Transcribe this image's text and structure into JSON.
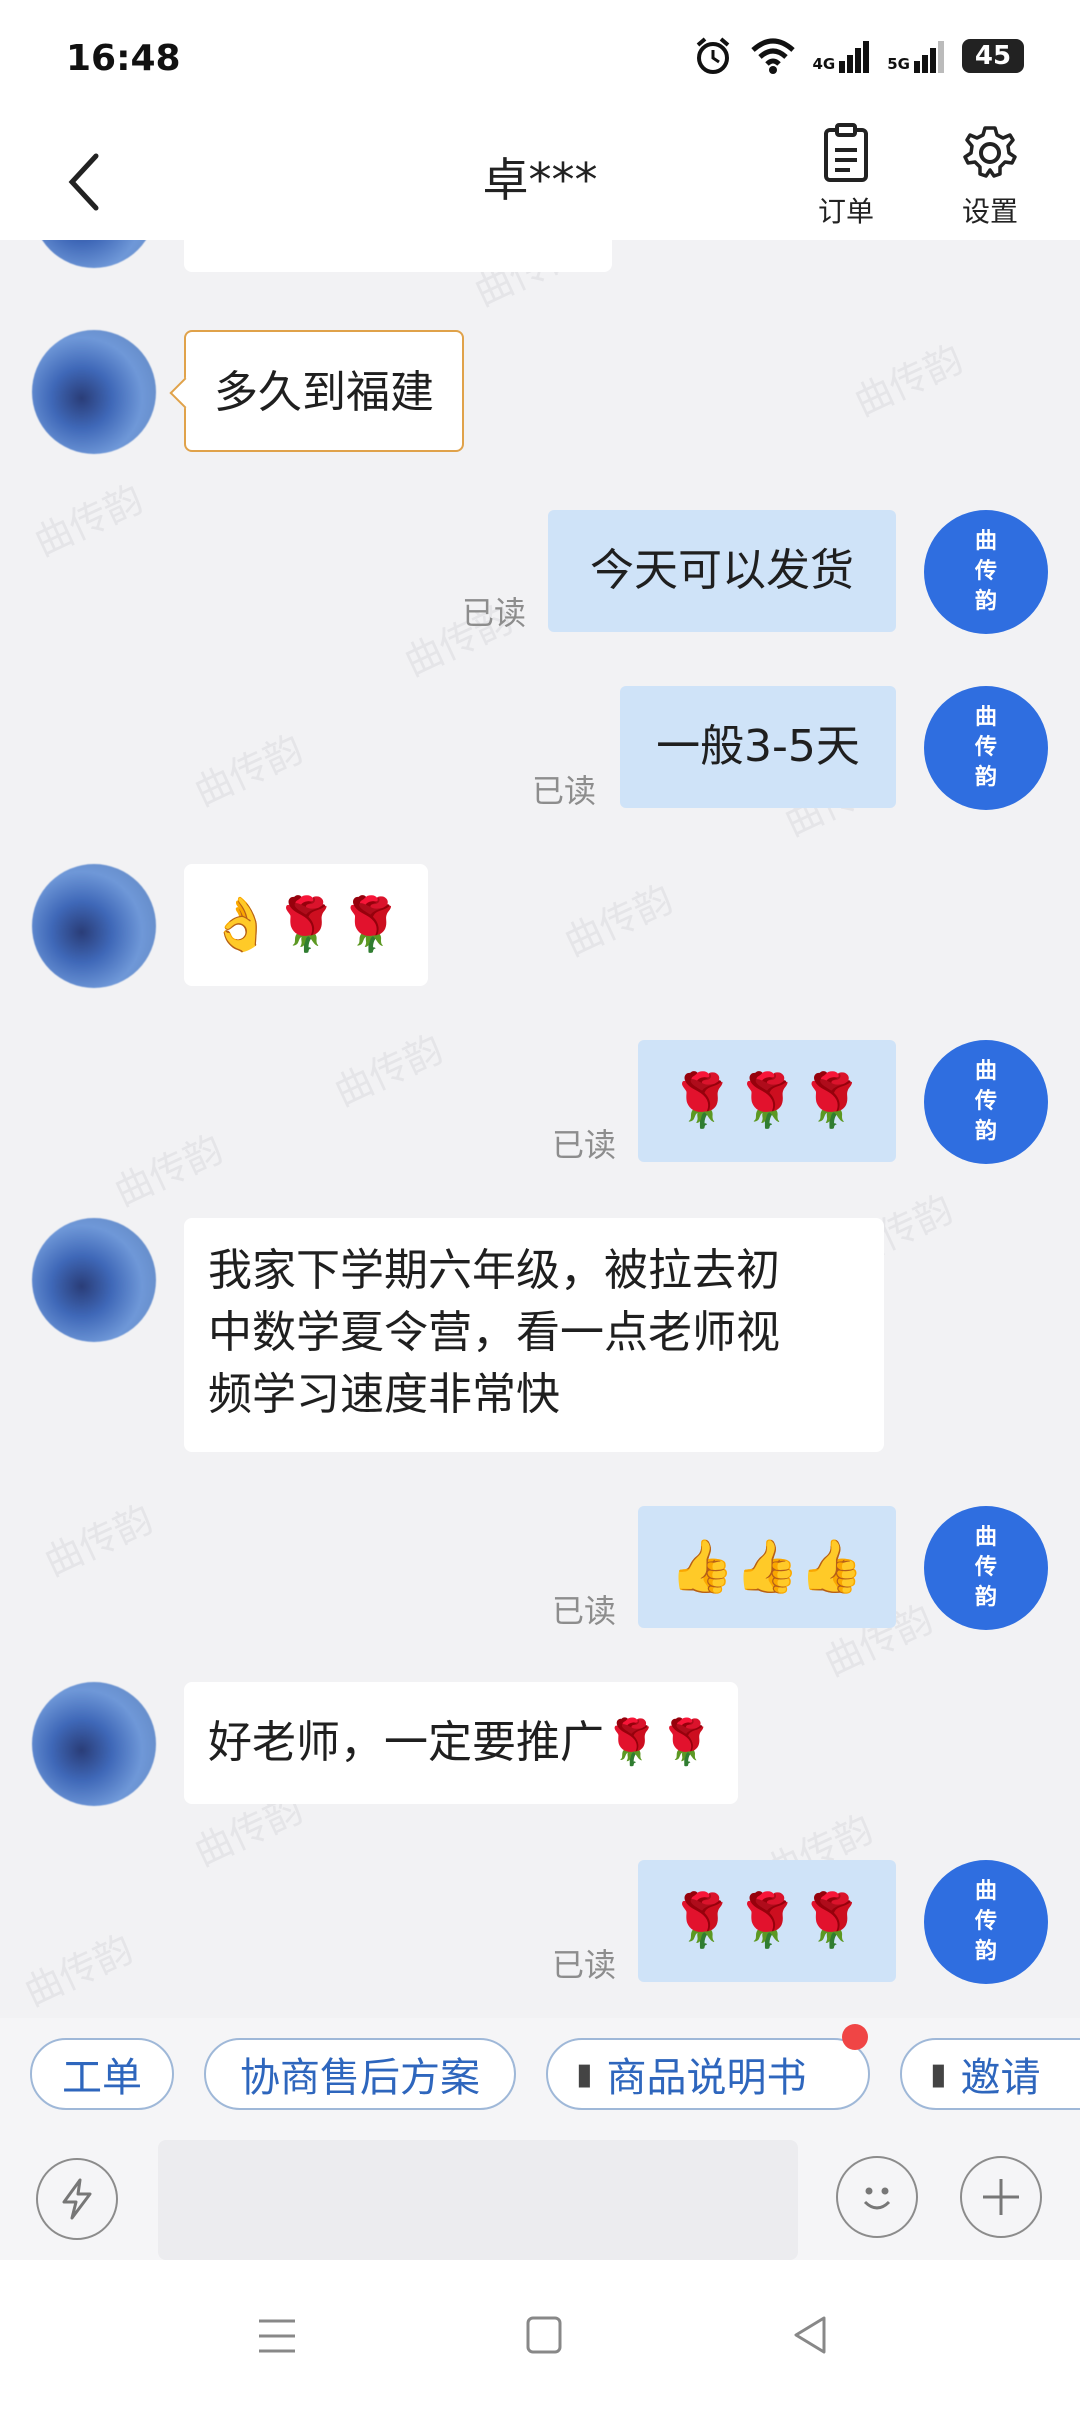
{
  "status": {
    "time": "16:48",
    "battery": "45",
    "net1": "4G",
    "net2": "5G"
  },
  "header": {
    "title": "卓***",
    "order_label": "订单",
    "settings_label": "设置"
  },
  "self_avatar": [
    "曲",
    "传",
    "韵"
  ],
  "watermark": "曲传韵",
  "messages": [
    {
      "from": "customer",
      "text": "多久到福建"
    },
    {
      "from": "self",
      "text": "今天可以发货",
      "read": "已读"
    },
    {
      "from": "self",
      "text": "一般3-5天",
      "read": "已读"
    },
    {
      "from": "customer",
      "text": "👌🌹🌹"
    },
    {
      "from": "self",
      "text": "🌹🌹🌹",
      "read": "已读"
    },
    {
      "from": "customer",
      "lines": [
        "我家下学期六年级，被拉去初",
        "中数学夏令营，看一点老师视",
        "频学习速度非常快"
      ]
    },
    {
      "from": "self",
      "text": "👍👍👍",
      "read": "已读"
    },
    {
      "from": "customer",
      "text": "好老师，一定要推广🌹🌹"
    },
    {
      "from": "self",
      "text": "🌹🌹🌹",
      "read": "已读"
    }
  ],
  "quick_actions": [
    "工单",
    "协商售后方案",
    "商品说明书",
    "邀请"
  ],
  "colors": {
    "accent": "#2f6ee0",
    "bubble_out": "#cfe3f8",
    "quick_text": "#2e66bd",
    "badge": "#f04545"
  }
}
